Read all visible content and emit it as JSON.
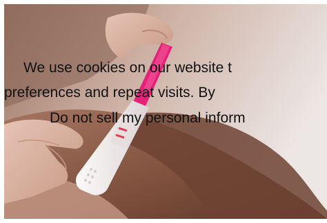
{
  "cookie_banner": {
    "line_1": "We use cookies on our website t",
    "line_2": "preferences and repeat visits. By",
    "line_3": "Do not sell my personal inform"
  },
  "colors": {
    "background": "#ffffff",
    "text": "#111111",
    "test_pink": "#e5217a",
    "test_white": "#f6f2f2",
    "result_line": "#e33a52"
  }
}
